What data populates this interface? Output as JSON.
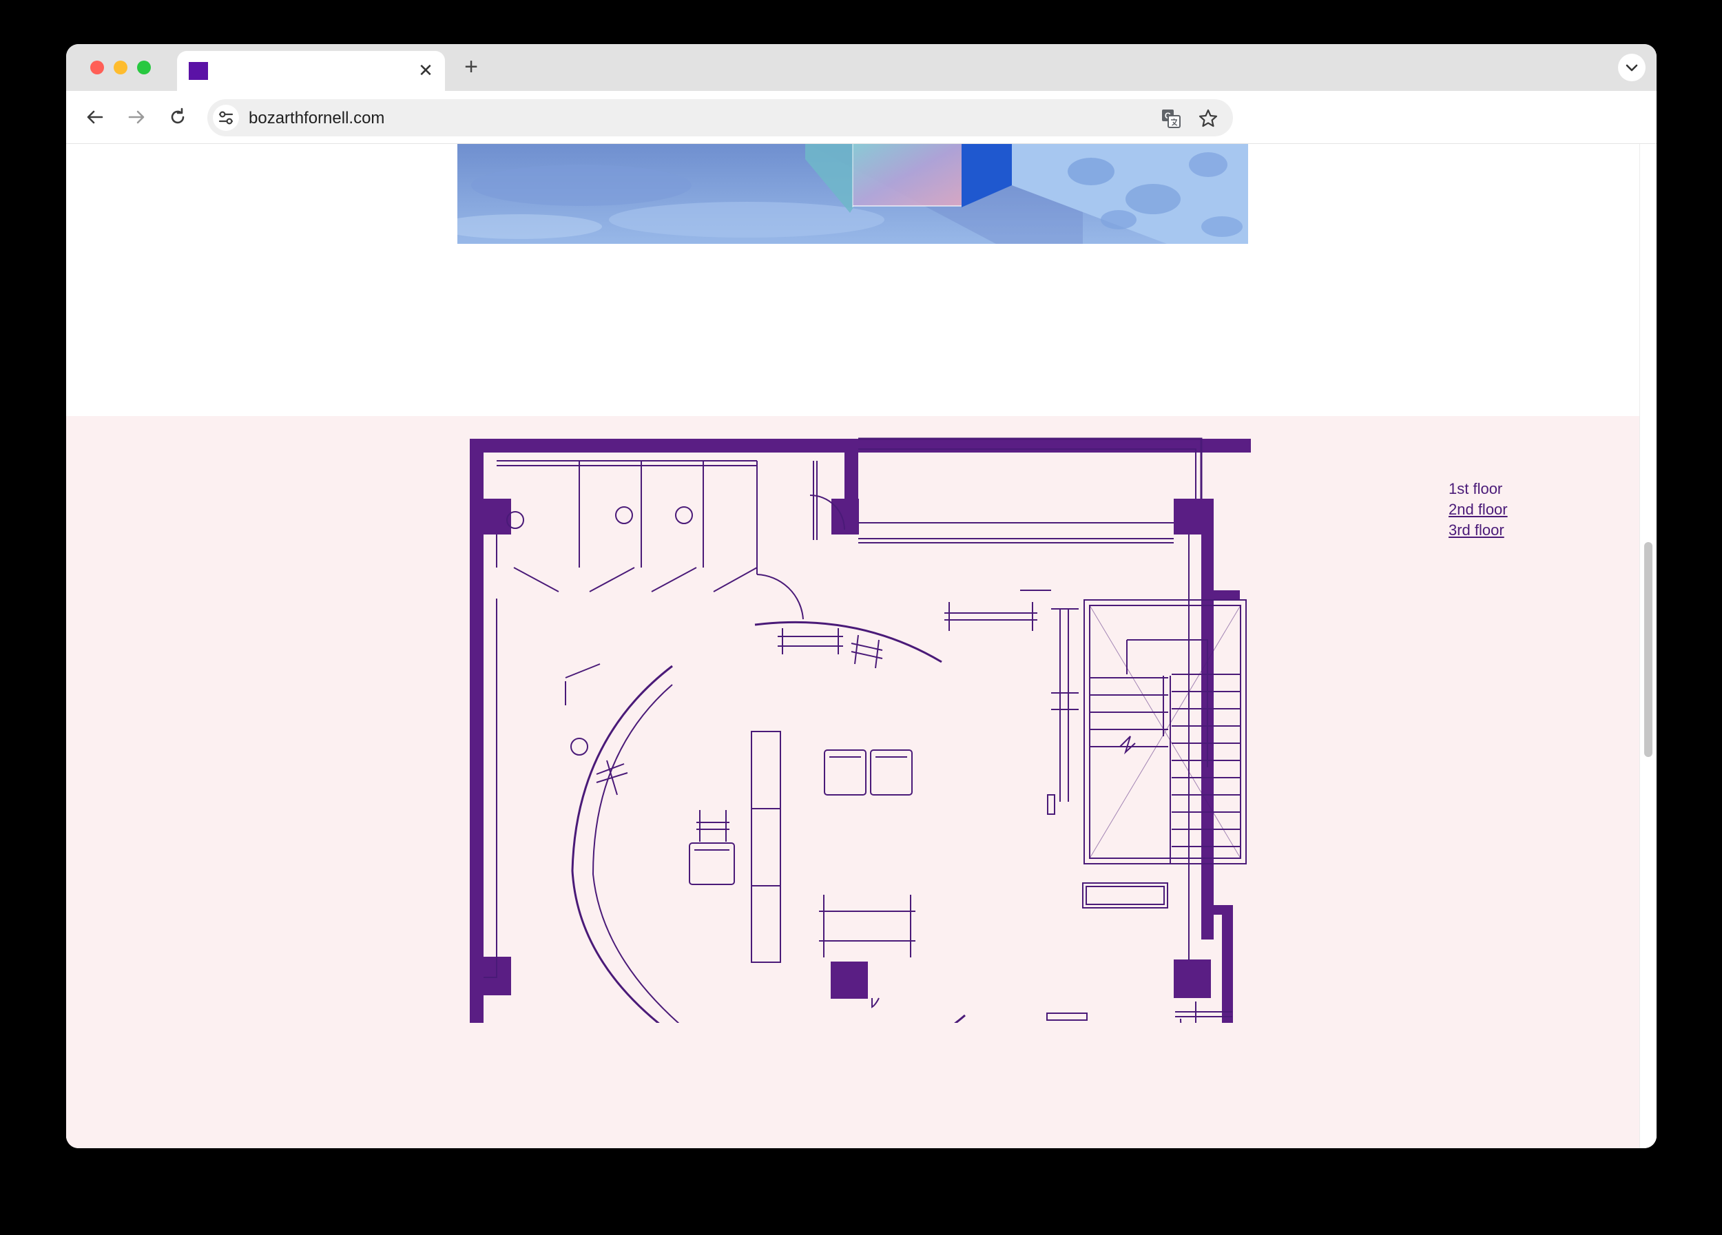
{
  "browser": {
    "tab": {
      "title": "",
      "close_icon": "close-icon"
    },
    "address_bar": {
      "url": "bozarthfornell.com"
    },
    "icons": [
      "back-arrow-icon",
      "forward-arrow-icon",
      "reload-icon",
      "site-info-icon",
      "translate-icon",
      "star-bookmark-icon",
      "tab-search-chevron-icon",
      "new-tab-plus-icon"
    ]
  },
  "page": {
    "floor_nav": {
      "items": [
        {
          "label": "1st floor",
          "active": true
        },
        {
          "label": "2nd floor",
          "active": false
        },
        {
          "label": "3rd floor",
          "active": false
        }
      ]
    }
  },
  "colors": {
    "plan_stroke": "#4a1a78",
    "plan_wall": "#5a1e84",
    "section_background": "#fcf0f1",
    "favicon": "#5b12a6"
  }
}
